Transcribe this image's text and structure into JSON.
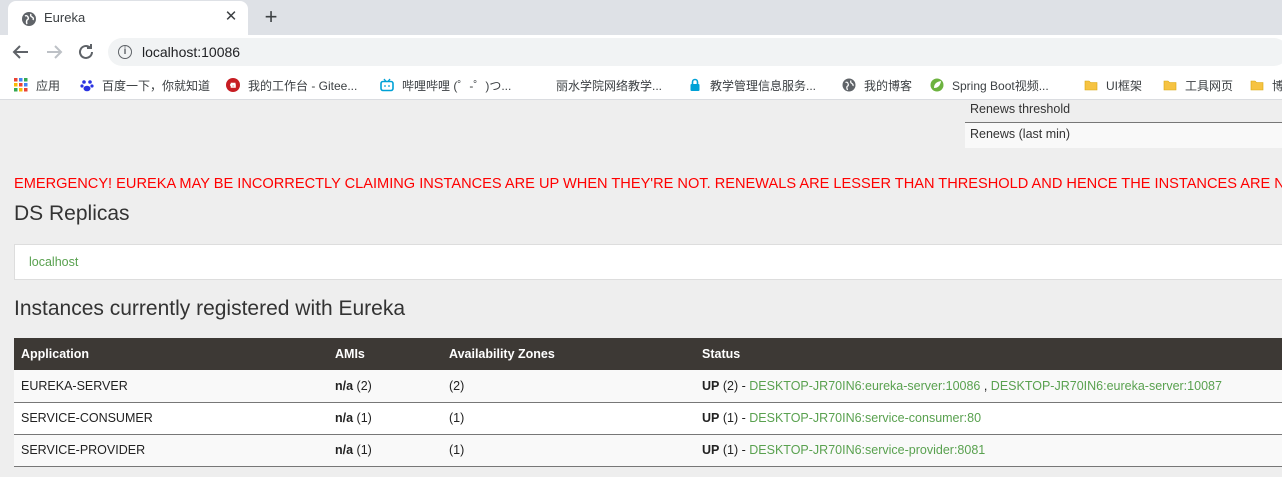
{
  "browser": {
    "tab_title": "Eureka",
    "url": "localhost:10086",
    "bookmarks": [
      {
        "label": "应用",
        "icon": "apps-grid-icon",
        "color": "#1a73e8"
      },
      {
        "label": "百度一下，你就知道",
        "icon": "baidu-paw-icon",
        "color": "#2932e1"
      },
      {
        "label": "我的工作台 - Gitee...",
        "icon": "gitee-icon",
        "color": "#c71d23"
      },
      {
        "label": "哔哩哔哩 (゜-゜)つ...",
        "icon": "bilibili-icon",
        "color": "#00a1d6"
      },
      {
        "label": "丽水学院网络教学...",
        "icon": "blank-page-icon",
        "color": "#ffffff"
      },
      {
        "label": "教学管理信息服务...",
        "icon": "lock-icon",
        "color": "#00a1d6"
      },
      {
        "label": "我的博客",
        "icon": "globe-icon",
        "color": "#5f6368"
      },
      {
        "label": "Spring Boot视频...",
        "icon": "spring-leaf-icon",
        "color": "#6db33f"
      },
      {
        "label": "UI框架",
        "icon": "folder-icon",
        "color": "#f6c342"
      },
      {
        "label": "工具网页",
        "icon": "folder-icon",
        "color": "#f6c342"
      },
      {
        "label": "博",
        "icon": "folder-icon",
        "color": "#f6c342"
      }
    ]
  },
  "renews": {
    "threshold_label": "Renews threshold",
    "last_min_label": "Renews (last min)"
  },
  "emergency_message": "EMERGENCY! EUREKA MAY BE INCORRECTLY CLAIMING INSTANCES ARE UP WHEN THEY'RE NOT. RENEWALS ARE LESSER THAN THRESHOLD AND HENCE THE INSTANCES ARE NOT BEING EXPIRED JUST TO BE SAFE.",
  "ds_replicas": {
    "heading": "DS Replicas",
    "items": [
      "localhost"
    ]
  },
  "instances": {
    "heading": "Instances currently registered with Eureka",
    "columns": [
      "Application",
      "AMIs",
      "Availability Zones",
      "Status"
    ],
    "rows": [
      {
        "application": "EUREKA-SERVER",
        "ami_label": "n/a",
        "ami_count": "(2)",
        "zones": "(2)",
        "status": "UP",
        "status_count": "(2)",
        "links": [
          "DESKTOP-JR70IN6:eureka-server:10086",
          "DESKTOP-JR70IN6:eureka-server:10087"
        ]
      },
      {
        "application": "SERVICE-CONSUMER",
        "ami_label": "n/a",
        "ami_count": "(1)",
        "zones": "(1)",
        "status": "UP",
        "status_count": "(1)",
        "links": [
          "DESKTOP-JR70IN6:service-consumer:80"
        ]
      },
      {
        "application": "SERVICE-PROVIDER",
        "ami_label": "n/a",
        "ami_count": "(1)",
        "zones": "(1)",
        "status": "UP",
        "status_count": "(1)",
        "links": [
          "DESKTOP-JR70IN6:service-provider:8081"
        ]
      }
    ]
  },
  "colors": {
    "emergency": "#ff0000",
    "link": "#59a14f",
    "table_header": "#3d3935"
  }
}
